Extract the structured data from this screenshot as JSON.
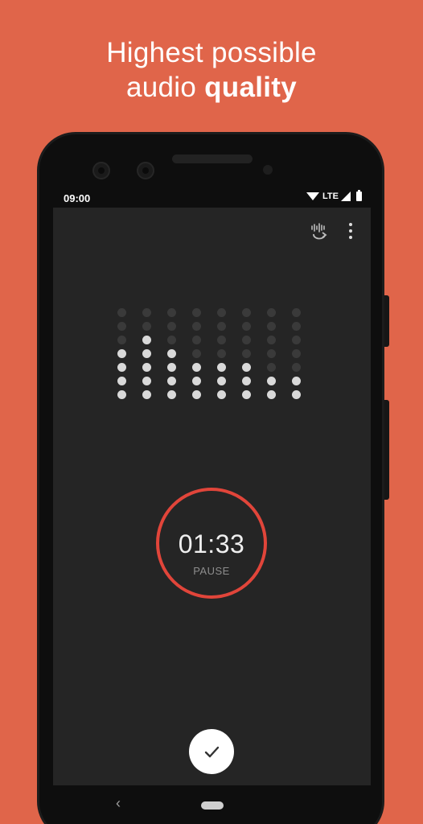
{
  "promo": {
    "line1": "Highest possible",
    "line2_regular": "audio ",
    "line2_bold": "quality"
  },
  "status_bar": {
    "time": "09:00",
    "network": "LTE"
  },
  "toolbar": {
    "icons": [
      "audio-source-icon",
      "more-vert-icon"
    ]
  },
  "recorder": {
    "elapsed": "01:33",
    "state_label": "PAUSE",
    "level_meter": {
      "rows": 7,
      "lit_dots_per_column": [
        4,
        5,
        4,
        3,
        3,
        3,
        2,
        2
      ]
    }
  },
  "actions": {
    "confirm_icon": "check-icon"
  },
  "nav": {
    "back_icon": "back-icon",
    "home_icon": "home-pill-icon"
  },
  "colors": {
    "background": "#e0654a",
    "screen": "#252525",
    "ring": "#e1453a",
    "dot_lit": "#d9d9d9",
    "dot_dim": "#3a3a3a"
  }
}
